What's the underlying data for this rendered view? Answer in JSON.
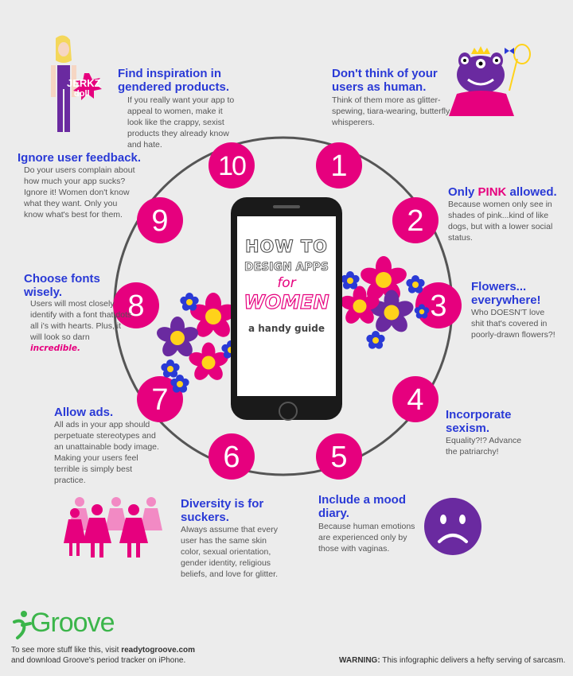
{
  "phone": {
    "line1": "HOW TO",
    "line2": "DESIGN APPS",
    "line3": "for",
    "line4": "WOMEN",
    "line5": "a handy guide"
  },
  "doll_label_1": "JERKZ",
  "doll_label_2": "doll",
  "tips": {
    "t10": {
      "number": "10",
      "title": "Find inspiration in gendered products.",
      "body": "If you really want your app to appeal to women, make it look like the crappy, sexist products they already know and hate."
    },
    "t1": {
      "number": "1",
      "title": "Don't think of your users as human.",
      "body": "Think of them more as glitter-spewing, tiara-wearing, butterfly whisperers."
    },
    "t9": {
      "number": "9",
      "title": "Ignore user feedback.",
      "body": "Do your users complain about how much your app sucks? Ignore it! Women don't know what they want. Only you know what's best for them."
    },
    "t2": {
      "number": "2",
      "title_pre": "Only ",
      "title_pink": "PINK",
      "title_post": " allowed.",
      "body": "Because women only see in shades of pink...kind of like dogs, but with a lower social status."
    },
    "t8": {
      "number": "8",
      "title": "Choose fonts wisely.",
      "body": "Users will most closely identify with a font that dots all i's with hearts. Plus, it will look so darn",
      "body_fancy": "incredible."
    },
    "t3": {
      "number": "3",
      "title": "Flowers... everywhere!",
      "body": "Who DOESN'T love shit that's covered in poorly-drawn flowers?!"
    },
    "t7": {
      "number": "7",
      "title": "Allow ads.",
      "body": "All ads in your app should perpetuate stereotypes and an unattainable body image. Making your users feel terrible is simply best practice."
    },
    "t4": {
      "number": "4",
      "title": "Incorporate sexism.",
      "body": "Equality?!? Advance the patriarchy!"
    },
    "t6": {
      "number": "6",
      "title": "Diversity is for suckers.",
      "body": "Always assume that every user has the same skin color, sexual orientation, gender identity, religious beliefs, and love for glitter."
    },
    "t5": {
      "number": "5",
      "title": "Include a mood diary.",
      "body": "Because human emotions are experienced only by those with vaginas."
    }
  },
  "footer": {
    "brand": "Groove",
    "line1_pre": "To see more stuff like this, visit ",
    "line1_link": "readytogroove.com",
    "line2": "and download Groove's period tracker on iPhone.",
    "warning_label": "WARNING:",
    "warning_text": " This infographic delivers a hefty serving of sarcasm."
  },
  "colors": {
    "pink": "#e6007e",
    "blue": "#2a3ad6",
    "purple": "#6a2aa0",
    "green": "#3bb54a"
  }
}
